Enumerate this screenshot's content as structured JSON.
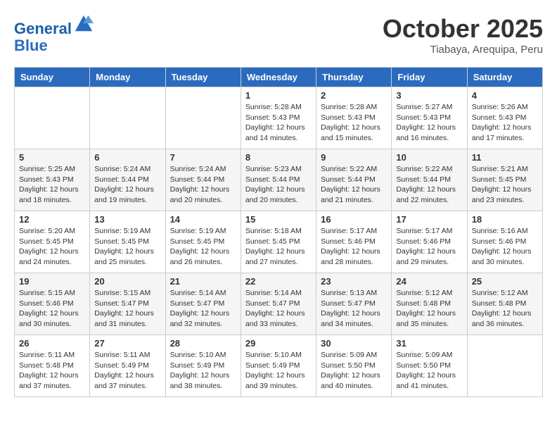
{
  "header": {
    "logo_line1": "General",
    "logo_line2": "Blue",
    "month_title": "October 2025",
    "location": "Tiabaya, Arequipa, Peru"
  },
  "days_of_week": [
    "Sunday",
    "Monday",
    "Tuesday",
    "Wednesday",
    "Thursday",
    "Friday",
    "Saturday"
  ],
  "weeks": [
    [
      {
        "day": "",
        "info": ""
      },
      {
        "day": "",
        "info": ""
      },
      {
        "day": "",
        "info": ""
      },
      {
        "day": "1",
        "info": "Sunrise: 5:28 AM\nSunset: 5:43 PM\nDaylight: 12 hours\nand 14 minutes."
      },
      {
        "day": "2",
        "info": "Sunrise: 5:28 AM\nSunset: 5:43 PM\nDaylight: 12 hours\nand 15 minutes."
      },
      {
        "day": "3",
        "info": "Sunrise: 5:27 AM\nSunset: 5:43 PM\nDaylight: 12 hours\nand 16 minutes."
      },
      {
        "day": "4",
        "info": "Sunrise: 5:26 AM\nSunset: 5:43 PM\nDaylight: 12 hours\nand 17 minutes."
      }
    ],
    [
      {
        "day": "5",
        "info": "Sunrise: 5:25 AM\nSunset: 5:43 PM\nDaylight: 12 hours\nand 18 minutes."
      },
      {
        "day": "6",
        "info": "Sunrise: 5:24 AM\nSunset: 5:44 PM\nDaylight: 12 hours\nand 19 minutes."
      },
      {
        "day": "7",
        "info": "Sunrise: 5:24 AM\nSunset: 5:44 PM\nDaylight: 12 hours\nand 20 minutes."
      },
      {
        "day": "8",
        "info": "Sunrise: 5:23 AM\nSunset: 5:44 PM\nDaylight: 12 hours\nand 20 minutes."
      },
      {
        "day": "9",
        "info": "Sunrise: 5:22 AM\nSunset: 5:44 PM\nDaylight: 12 hours\nand 21 minutes."
      },
      {
        "day": "10",
        "info": "Sunrise: 5:22 AM\nSunset: 5:44 PM\nDaylight: 12 hours\nand 22 minutes."
      },
      {
        "day": "11",
        "info": "Sunrise: 5:21 AM\nSunset: 5:45 PM\nDaylight: 12 hours\nand 23 minutes."
      }
    ],
    [
      {
        "day": "12",
        "info": "Sunrise: 5:20 AM\nSunset: 5:45 PM\nDaylight: 12 hours\nand 24 minutes."
      },
      {
        "day": "13",
        "info": "Sunrise: 5:19 AM\nSunset: 5:45 PM\nDaylight: 12 hours\nand 25 minutes."
      },
      {
        "day": "14",
        "info": "Sunrise: 5:19 AM\nSunset: 5:45 PM\nDaylight: 12 hours\nand 26 minutes."
      },
      {
        "day": "15",
        "info": "Sunrise: 5:18 AM\nSunset: 5:45 PM\nDaylight: 12 hours\nand 27 minutes."
      },
      {
        "day": "16",
        "info": "Sunrise: 5:17 AM\nSunset: 5:46 PM\nDaylight: 12 hours\nand 28 minutes."
      },
      {
        "day": "17",
        "info": "Sunrise: 5:17 AM\nSunset: 5:46 PM\nDaylight: 12 hours\nand 29 minutes."
      },
      {
        "day": "18",
        "info": "Sunrise: 5:16 AM\nSunset: 5:46 PM\nDaylight: 12 hours\nand 30 minutes."
      }
    ],
    [
      {
        "day": "19",
        "info": "Sunrise: 5:15 AM\nSunset: 5:46 PM\nDaylight: 12 hours\nand 30 minutes."
      },
      {
        "day": "20",
        "info": "Sunrise: 5:15 AM\nSunset: 5:47 PM\nDaylight: 12 hours\nand 31 minutes."
      },
      {
        "day": "21",
        "info": "Sunrise: 5:14 AM\nSunset: 5:47 PM\nDaylight: 12 hours\nand 32 minutes."
      },
      {
        "day": "22",
        "info": "Sunrise: 5:14 AM\nSunset: 5:47 PM\nDaylight: 12 hours\nand 33 minutes."
      },
      {
        "day": "23",
        "info": "Sunrise: 5:13 AM\nSunset: 5:47 PM\nDaylight: 12 hours\nand 34 minutes."
      },
      {
        "day": "24",
        "info": "Sunrise: 5:12 AM\nSunset: 5:48 PM\nDaylight: 12 hours\nand 35 minutes."
      },
      {
        "day": "25",
        "info": "Sunrise: 5:12 AM\nSunset: 5:48 PM\nDaylight: 12 hours\nand 36 minutes."
      }
    ],
    [
      {
        "day": "26",
        "info": "Sunrise: 5:11 AM\nSunset: 5:48 PM\nDaylight: 12 hours\nand 37 minutes."
      },
      {
        "day": "27",
        "info": "Sunrise: 5:11 AM\nSunset: 5:49 PM\nDaylight: 12 hours\nand 37 minutes."
      },
      {
        "day": "28",
        "info": "Sunrise: 5:10 AM\nSunset: 5:49 PM\nDaylight: 12 hours\nand 38 minutes."
      },
      {
        "day": "29",
        "info": "Sunrise: 5:10 AM\nSunset: 5:49 PM\nDaylight: 12 hours\nand 39 minutes."
      },
      {
        "day": "30",
        "info": "Sunrise: 5:09 AM\nSunset: 5:50 PM\nDaylight: 12 hours\nand 40 minutes."
      },
      {
        "day": "31",
        "info": "Sunrise: 5:09 AM\nSunset: 5:50 PM\nDaylight: 12 hours\nand 41 minutes."
      },
      {
        "day": "",
        "info": ""
      }
    ]
  ]
}
